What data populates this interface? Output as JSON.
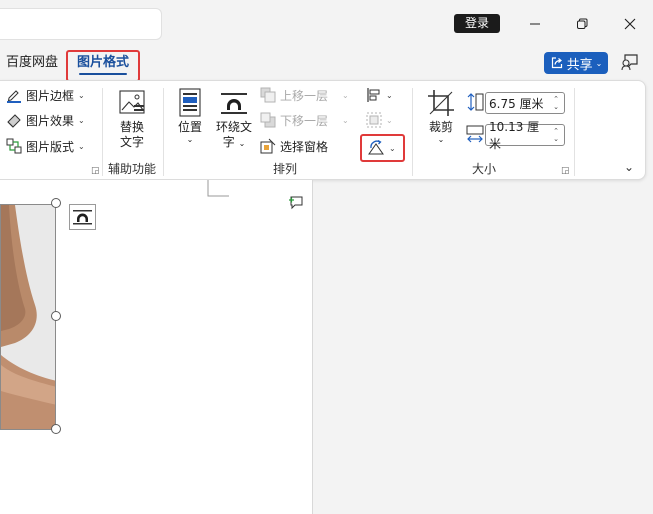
{
  "titlebar": {
    "login_label": "登录"
  },
  "tabs": {
    "baidu_label": "百度网盘",
    "picture_format_label": "图片格式"
  },
  "share": {
    "label": "共享"
  },
  "ribbon": {
    "styles_group": {
      "border_label": "图片边框",
      "effects_label": "图片效果",
      "layout_label": "图片版式"
    },
    "accessibility_group": {
      "alt_text_line1": "替换",
      "alt_text_line2": "文字",
      "group_label": "辅助功能"
    },
    "arrange_group": {
      "position_label": "位置",
      "wrap_text_line1": "环绕文",
      "wrap_text_line2": "字",
      "bring_forward_label": "上移一层",
      "send_backward_label": "下移一层",
      "selection_pane_label": "选择窗格",
      "group_label": "排列"
    },
    "size_group": {
      "crop_label": "裁剪",
      "height_value": "6.75 厘米",
      "width_value": "10.13 厘米",
      "group_label": "大小"
    }
  },
  "colors": {
    "accent_blue": "#1a4f9c",
    "share_blue": "#1b5fbd",
    "highlight_red": "#e03a3a"
  }
}
